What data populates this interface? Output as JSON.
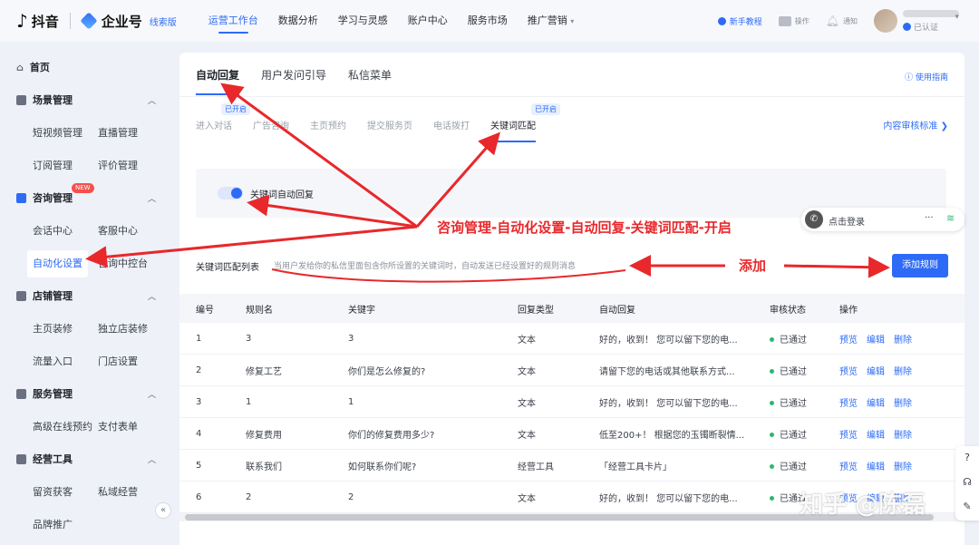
{
  "header": {
    "app_name": "抖音",
    "product_name": "企业号",
    "version_tag": "线索版",
    "nav": [
      "运营工作台",
      "数据分析",
      "学习与灵感",
      "账户中心",
      "服务市场",
      "推广营销"
    ],
    "nav_active": "运营工作台",
    "tutorial": "新手教程",
    "ops": "操作",
    "notify": "通知",
    "verified": "已认证"
  },
  "sidebar": {
    "home": "首页",
    "groups": [
      {
        "title": "场景管理",
        "items": [
          "短视频管理",
          "直播管理",
          "订阅管理",
          "评价管理"
        ]
      },
      {
        "title": "咨询管理",
        "badge": "NEW",
        "items": [
          "会话中心",
          "客服中心",
          "自动化设置",
          "咨询中控台"
        ]
      },
      {
        "title": "店铺管理",
        "items": [
          "主页装修",
          "独立店装修",
          "流量入口",
          "门店设置"
        ]
      },
      {
        "title": "服务管理",
        "items": [
          "高级在线预约",
          "支付表单"
        ]
      },
      {
        "title": "经营工具",
        "items": [
          "留资获客",
          "私域经营",
          "品牌推广"
        ]
      }
    ],
    "active_item": "自动化设置",
    "collapse_icon": "«"
  },
  "main": {
    "tabs": [
      "自动回复",
      "用户发问引导",
      "私信菜单"
    ],
    "active_tab": "自动回复",
    "guide": "使用指南",
    "subtabs": [
      "进入对话",
      "广告咨询",
      "主页预约",
      "提交服务页",
      "电话拨打",
      "关键词匹配"
    ],
    "active_subtab": "关键词匹配",
    "on_tag": "已开启",
    "audit_std": "内容审核标准",
    "toggle_label": "关键词自动回复",
    "toggle_on": true,
    "list_title": "关键词匹配列表",
    "list_desc": "当用户发给你的私信里面包含你所设置的关键词时，自动发送已经设置好的规则消息",
    "add_button": "添加规则"
  },
  "table": {
    "columns": [
      "编号",
      "规则名",
      "关键字",
      "回复类型",
      "自动回复",
      "审核状态",
      "操作"
    ],
    "rows": [
      {
        "id": "1",
        "name": "3",
        "keyword": "3",
        "type": "文本",
        "reply": "好的，收到！ 您可以留下您的电...",
        "status": "已通过"
      },
      {
        "id": "2",
        "name": "修复工艺",
        "keyword": "你们是怎么修复的?",
        "type": "文本",
        "reply": "请留下您的电话或其他联系方式...",
        "status": "已通过"
      },
      {
        "id": "3",
        "name": "1",
        "keyword": "1",
        "type": "文本",
        "reply": "好的，收到！ 您可以留下您的电...",
        "status": "已通过"
      },
      {
        "id": "4",
        "name": "修复费用",
        "keyword": "你们的修复费用多少?",
        "type": "文本",
        "reply": "低至200+！ 根据您的玉镯断裂情...",
        "status": "已通过"
      },
      {
        "id": "5",
        "name": "联系我们",
        "keyword": "如何联系你们呢?",
        "type": "经营工具",
        "reply": "「经营工具卡片」",
        "status": "已通过"
      },
      {
        "id": "6",
        "name": "2",
        "keyword": "2",
        "type": "文本",
        "reply": "好的，收到！ 您可以留下您的电...",
        "status": "已通过"
      }
    ],
    "ops": [
      "预览",
      "编辑",
      "删除"
    ]
  },
  "floating": {
    "phone_label": "点击登录",
    "phone_more": "···",
    "phone_signal": "wifi-icon"
  },
  "annotations": {
    "path_note": "咨询管理-自动化设置-自动回复-关键词匹配-开启",
    "add_note": "添加",
    "color": "#e8282b"
  },
  "watermark": "知乎 @陈磊"
}
